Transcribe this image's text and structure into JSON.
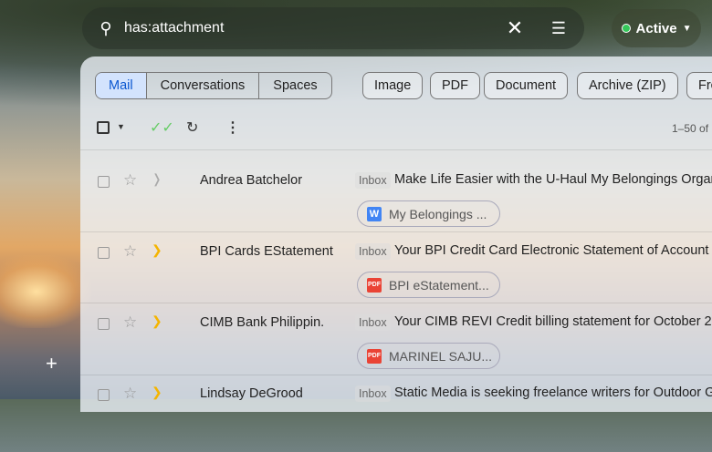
{
  "search": {
    "query": "has:attachment"
  },
  "status": {
    "label": "Active",
    "color": "#34c759"
  },
  "tabs": [
    "Mail",
    "Conversations",
    "Spaces"
  ],
  "filters": [
    "Image",
    "PDF",
    "Document",
    "Archive (ZIP)",
    "Fro"
  ],
  "toolbar": {
    "count": "1–50 of"
  },
  "emails": [
    {
      "sender": "Andrea Batchelor",
      "label": "Inbox",
      "subject": "Make Life Easier with the U-Haul My Belongings Organiz",
      "attachment": "My Belongings ...",
      "file_type": "W",
      "important": false
    },
    {
      "sender": "BPI Cards EStatement",
      "label": "Inbox",
      "subject": "Your BPI Credit Card Electronic Statement of Account - D",
      "attachment": "BPI eStatement...",
      "file_type": "PDF",
      "important": true
    },
    {
      "sender": "CIMB Bank Philippin.",
      "label": "Inbox",
      "subject": "Your CIMB REVI Credit billing statement for October 202",
      "attachment": "MARINEL SAJU...",
      "file_type": "PDF",
      "important": true
    },
    {
      "sender": "Lindsay DeGrood",
      "label": "Inbox",
      "subject": "Static Media is seeking freelance writers for Outdoor Gu",
      "important": true
    }
  ]
}
